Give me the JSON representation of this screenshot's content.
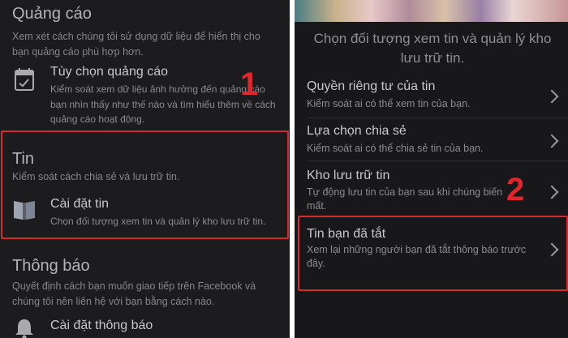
{
  "left": {
    "ads": {
      "title": "Quảng cáo",
      "desc": "Xem xét cách chúng tôi sử dụng dữ liệu để hiển thị cho bạn quảng cáo phù hợp hơn.",
      "item": {
        "title": "Tùy chọn quảng cáo",
        "desc": "Kiểm soát xem dữ liệu ảnh hưởng đến quảng cáo bạn nhìn thấy như thế nào và tìm hiểu thêm về cách quảng cáo hoạt động.",
        "icon": "calendar-icon"
      }
    },
    "stories": {
      "title": "Tin",
      "desc": "Kiểm soát cách chia sẻ và lưu trữ tin.",
      "item": {
        "title": "Cài đặt tin",
        "desc": "Chọn đối tượng xem tin và quản lý kho lưu trữ tin.",
        "icon": "book-icon"
      }
    },
    "notifications": {
      "title": "Thông báo",
      "desc": "Quyết định cách bạn muốn giao tiếp trên Facebook và chúng tôi nên liên hệ với bạn bằng cách nào.",
      "item": {
        "title": "Cài đặt thông báo",
        "icon": "bell-icon"
      }
    },
    "step_badge": "1"
  },
  "right": {
    "header": "Chọn đối tượng xem tin và quản lý kho lưu trữ tin.",
    "items": [
      {
        "title": "Quyền riêng tư của tin",
        "desc": "Kiểm soát ai có thể xem tin của bạn."
      },
      {
        "title": "Lựa chọn chia sẻ",
        "desc": "Kiểm soát ai có thể chia sẻ tin của bạn."
      },
      {
        "title": "Kho lưu trữ tin",
        "desc": "Tự động lưu tin của bạn sau khi chúng biến mất."
      },
      {
        "title": "Tin bạn đã tắt",
        "desc": "Xem lại những người bạn đã tắt thông báo trước đây."
      }
    ],
    "step_badge": "2"
  },
  "colors": {
    "highlight": "#d8292f",
    "background": "#1c1c1e"
  }
}
